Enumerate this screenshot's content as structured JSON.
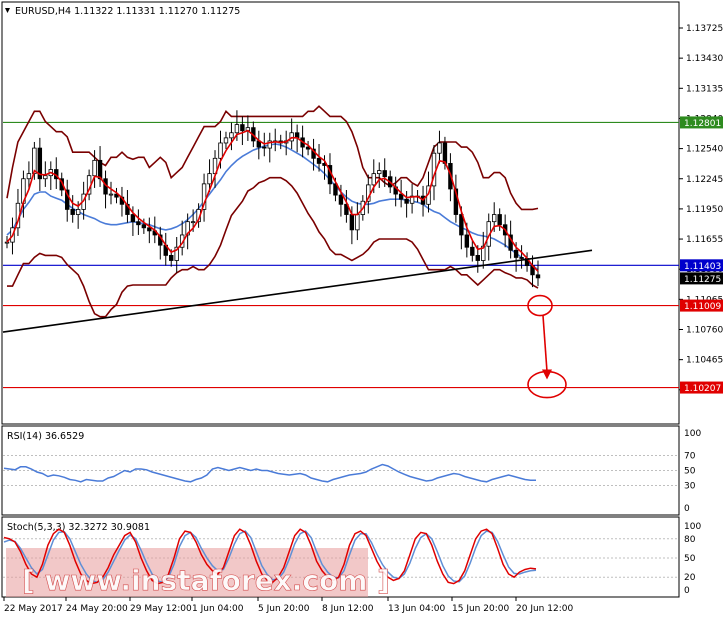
{
  "chart_data": {
    "type": "candlestick",
    "symbol_header": "EURUSD,H4  1.11322 1.11331 1.11270 1.11275",
    "price_axis": {
      "ylim": [
        1.1017,
        1.1406
      ],
      "ticks": [
        "1.13725",
        "1.13430",
        "1.13135",
        "1.12840",
        "1.12540",
        "1.12245",
        "1.11950",
        "1.11655",
        "1.11360",
        "1.11065",
        "1.10760",
        "1.10465",
        "1.10170"
      ]
    },
    "x_tick_labels": [
      "22 May 2017",
      "24 May 20:00",
      "29 May 12:00",
      "1 Jun 04:00",
      "5 Jun 20:00",
      "8 Jun 12:00",
      "13 Jun 04:00",
      "15 Jun 20:00",
      "20 Jun 12:00"
    ],
    "levels": [
      {
        "label": "1.12801",
        "value": 1.12801,
        "color": "#2e8b1f",
        "tag_color": "#2e8b1f"
      },
      {
        "label": "1.11403",
        "value": 1.11403,
        "color": "#0000cc",
        "tag_color": "#0000cc"
      },
      {
        "label": "1.11275",
        "value": 1.11275,
        "color": null,
        "tag_color": "#000000"
      },
      {
        "label": "1.11009",
        "value": 1.11009,
        "color": "#e00000",
        "tag_color": "#e00000"
      },
      {
        "label": "1.10207",
        "value": 1.10207,
        "color": "#e00000",
        "tag_color": "#e00000"
      }
    ],
    "trendline": {
      "color": "#000000",
      "points": [
        [
          "22 May 2017",
          1.1075
        ],
        [
          "21 Jun",
          1.1155
        ]
      ]
    },
    "projection": {
      "color": "#e00000",
      "from": 1.11009,
      "to": 1.10207
    },
    "series": [
      {
        "name": "EURUSD,H4",
        "type": "candlestick",
        "close": [
          1.1163,
          1.1177,
          1.1201,
          1.1225,
          1.123,
          1.1255,
          1.1225,
          1.1228,
          1.1234,
          1.1225,
          1.1214,
          1.1195,
          1.119,
          1.1195,
          1.121,
          1.1228,
          1.1243,
          1.1225,
          1.121,
          1.121,
          1.1207,
          1.12,
          1.119,
          1.1183,
          1.118,
          1.1177,
          1.1174,
          1.117,
          1.116,
          1.115,
          1.1145,
          1.1158,
          1.117,
          1.1183,
          1.1183,
          1.1195,
          1.122,
          1.123,
          1.1245,
          1.126,
          1.1265,
          1.127,
          1.1278,
          1.1272,
          1.1275,
          1.1262,
          1.1256,
          1.1255,
          1.1262,
          1.1262,
          1.126,
          1.1262,
          1.127,
          1.1265,
          1.1256,
          1.1254,
          1.1245,
          1.124,
          1.1238,
          1.122,
          1.1209,
          1.12,
          1.119,
          1.1175,
          1.119,
          1.1203,
          1.1219,
          1.123,
          1.1233,
          1.1227,
          1.1217,
          1.121,
          1.1205,
          1.1201,
          1.1208,
          1.1208,
          1.12,
          1.1218,
          1.125,
          1.126,
          1.124,
          1.1215,
          1.119,
          1.117,
          1.1158,
          1.115,
          1.1145,
          1.1159,
          1.1183,
          1.119,
          1.118,
          1.117,
          1.1155,
          1.1148,
          1.1147,
          1.114,
          1.1131,
          1.1128
        ]
      },
      {
        "name": "Bollinger upper",
        "values": [
          1.1206,
          1.1236,
          1.1261,
          1.1271,
          1.1281,
          1.1291,
          1.1291,
          1.1281,
          1.1276,
          1.1271,
          1.1271,
          1.1266,
          1.1251,
          1.1251,
          1.1251,
          1.1251,
          1.1246,
          1.1241,
          1.1238,
          1.1246,
          1.1246,
          1.1251,
          1.1246,
          1.1244,
          1.1246,
          1.1246,
          1.1236,
          1.1241,
          1.1246,
          1.1241,
          1.1226,
          1.1231,
          1.1236,
          1.1246,
          1.1256,
          1.1266,
          1.1276,
          1.1276,
          1.1276,
          1.1281,
          1.1291,
          1.1286,
          1.1286,
          1.1286,
          1.1286,
          1.1286,
          1.1286,
          1.1286,
          1.1286,
          1.1286,
          1.1286,
          1.1286,
          1.1286,
          1.1286,
          1.1286,
          1.1291,
          1.1291,
          1.1296,
          1.1291,
          1.1286,
          1.1286,
          1.1286,
          1.1281,
          1.1271,
          1.1256,
          1.1236,
          1.1226,
          1.1226,
          1.1226,
          1.1221,
          1.1218,
          1.1221,
          1.1226,
          1.1226,
          1.1221,
          1.1218,
          1.1226,
          1.1241,
          1.1256,
          1.1261,
          1.1261,
          1.1261,
          1.1261,
          1.1256,
          1.1256,
          1.1251,
          1.1241,
          1.1226,
          1.1226,
          1.1231,
          1.1231,
          1.1226,
          1.1211,
          1.1201,
          1.1195,
          1.1195,
          1.1195,
          1.1196
        ]
      },
      {
        "name": "Bollinger lower",
        "values": [
          1.112,
          1.112,
          1.1131,
          1.1142,
          1.1142,
          1.1148,
          1.1152,
          1.115,
          1.115,
          1.115,
          1.1148,
          1.1141,
          1.1136,
          1.1131,
          1.112,
          1.1105,
          1.1093,
          1.109,
          1.109,
          1.1097,
          1.1102,
          1.1114,
          1.112,
          1.1121,
          1.1121,
          1.1121,
          1.1121,
          1.1121,
          1.1121,
          1.1121,
          1.1128,
          1.1133,
          1.1136,
          1.1136,
          1.1139,
          1.1136,
          1.1136,
          1.1141,
          1.1149,
          1.116,
          1.1175,
          1.1189,
          1.1196,
          1.1203,
          1.1213,
          1.1216,
          1.1221,
          1.1223,
          1.1226,
          1.1226,
          1.1226,
          1.1223,
          1.1218,
          1.1211,
          1.1201,
          1.1191,
          1.1183,
          1.1173,
          1.1166,
          1.1156,
          1.1151,
          1.1151,
          1.1148,
          1.1145,
          1.1148,
          1.1151,
          1.1156,
          1.1163,
          1.1166,
          1.1166,
          1.1166,
          1.1166,
          1.1166,
          1.1166,
          1.1163,
          1.1156,
          1.1146,
          1.1136,
          1.1136,
          1.1136,
          1.1136,
          1.1139,
          1.1136,
          1.1131,
          1.1131,
          1.1126,
          1.1121,
          1.1126,
          1.1131,
          1.1136,
          1.1136,
          1.1133,
          1.1131,
          1.1128,
          1.1128,
          1.1126,
          1.1121,
          1.1118
        ]
      },
      {
        "name": "Bollinger middle",
        "values": [
          1.117,
          1.1175,
          1.1185,
          1.1195,
          1.1202,
          1.121,
          1.1212,
          1.1212,
          1.1208,
          1.1206,
          1.1204,
          1.12,
          1.1196,
          1.1193,
          1.119,
          1.1188,
          1.1186,
          1.1183,
          1.1181,
          1.118,
          1.118,
          1.1181,
          1.1182,
          1.1183,
          1.1182,
          1.1181,
          1.118,
          1.1178,
          1.1176,
          1.1175,
          1.1176,
          1.1178,
          1.1181,
          1.1185,
          1.119,
          1.1196,
          1.1203,
          1.121,
          1.1217,
          1.1224,
          1.1232,
          1.1238,
          1.1243,
          1.1247,
          1.125,
          1.1253,
          1.1255,
          1.1257,
          1.1258,
          1.1259,
          1.1258,
          1.1256,
          1.1253,
          1.125,
          1.1247,
          1.1243,
          1.1239,
          1.1235,
          1.123,
          1.1224,
          1.1218,
          1.1212,
          1.1207,
          1.1203,
          1.1201,
          1.12,
          1.12,
          1.1201,
          1.1203,
          1.1204,
          1.1205,
          1.1205,
          1.1205,
          1.1204,
          1.1203,
          1.1202,
          1.12,
          1.1196,
          1.1193,
          1.1191,
          1.1187,
          1.1183,
          1.118,
          1.1177,
          1.1175,
          1.1172,
          1.117,
          1.1169,
          1.1168,
          1.1166,
          1.1163,
          1.116,
          1.1156,
          1.1152,
          1.1148,
          1.1144,
          1.114,
          1.1136
        ]
      }
    ],
    "rsi": {
      "header": "RSI(14) 36.6529",
      "ylim": [
        0,
        100
      ],
      "ticks": [
        "100",
        "70",
        "50",
        "30",
        "0"
      ],
      "values": [
        53,
        52,
        51,
        55,
        55,
        52,
        48,
        46,
        42,
        44,
        43,
        41,
        38,
        37,
        35,
        38,
        37,
        36,
        36,
        40,
        42,
        46,
        50,
        48,
        52,
        52,
        51,
        48,
        46,
        44,
        42,
        40,
        38,
        36,
        35,
        38,
        40,
        44,
        52,
        54,
        52,
        50,
        52,
        54,
        52,
        50,
        52,
        50,
        50,
        48,
        46,
        45,
        44,
        45,
        46,
        44,
        40,
        38,
        36,
        35,
        38,
        40,
        42,
        44,
        45,
        46,
        48,
        52,
        55,
        58,
        56,
        52,
        48,
        45,
        42,
        40,
        38,
        36,
        37,
        40,
        42,
        44,
        46,
        45,
        42,
        40,
        38,
        36,
        35,
        38,
        40,
        42,
        44,
        42,
        40,
        38,
        37,
        37
      ]
    },
    "stoch": {
      "header": "Stoch(5,3,3) 32.3272 30.9081",
      "ylim": [
        0,
        100
      ],
      "ticks": [
        "100",
        "80",
        "50",
        "20",
        "0"
      ],
      "main": [
        82,
        80,
        75,
        60,
        40,
        25,
        20,
        40,
        70,
        88,
        95,
        90,
        70,
        45,
        25,
        15,
        10,
        12,
        20,
        35,
        55,
        70,
        85,
        90,
        75,
        50,
        30,
        15,
        10,
        12,
        25,
        50,
        80,
        92,
        90,
        75,
        55,
        40,
        30,
        25,
        35,
        60,
        85,
        95,
        90,
        70,
        45,
        25,
        15,
        12,
        20,
        35,
        60,
        85,
        95,
        90,
        70,
        45,
        30,
        20,
        15,
        20,
        40,
        70,
        88,
        92,
        85,
        65,
        45,
        30,
        20,
        15,
        18,
        30,
        55,
        80,
        90,
        88,
        70,
        45,
        25,
        12,
        10,
        15,
        30,
        55,
        80,
        92,
        95,
        88,
        65,
        40,
        25,
        20,
        28,
        32,
        34,
        33
      ],
      "signal": [
        75,
        78,
        76,
        65,
        50,
        35,
        25,
        32,
        55,
        78,
        90,
        91,
        80,
        60,
        40,
        25,
        15,
        12,
        16,
        28,
        45,
        62,
        78,
        86,
        80,
        62,
        42,
        25,
        14,
        12,
        20,
        40,
        68,
        85,
        90,
        82,
        65,
        50,
        38,
        30,
        32,
        50,
        72,
        88,
        92,
        82,
        60,
        38,
        24,
        16,
        17,
        28,
        48,
        72,
        88,
        92,
        82,
        60,
        40,
        28,
        20,
        19,
        30,
        55,
        78,
        88,
        88,
        74,
        56,
        40,
        28,
        20,
        18,
        25,
        42,
        65,
        82,
        88,
        80,
        60,
        38,
        22,
        14,
        13,
        22,
        42,
        66,
        85,
        92,
        90,
        76,
        55,
        36,
        26,
        25,
        28,
        30,
        31
      ],
      "main_color": "#e00000",
      "signal_color": "#5f8fd6"
    },
    "colors": {
      "candle": "#000000",
      "bb_bands": "#7a0000",
      "ma_fast": "#e00000",
      "ma_slow": "#4a7bd8",
      "rsi": "#4a7bd8",
      "grid": "#bfbfbf"
    }
  },
  "watermark": {
    "text": "[ www.instaforex.com ]",
    "color": "#e05050"
  }
}
